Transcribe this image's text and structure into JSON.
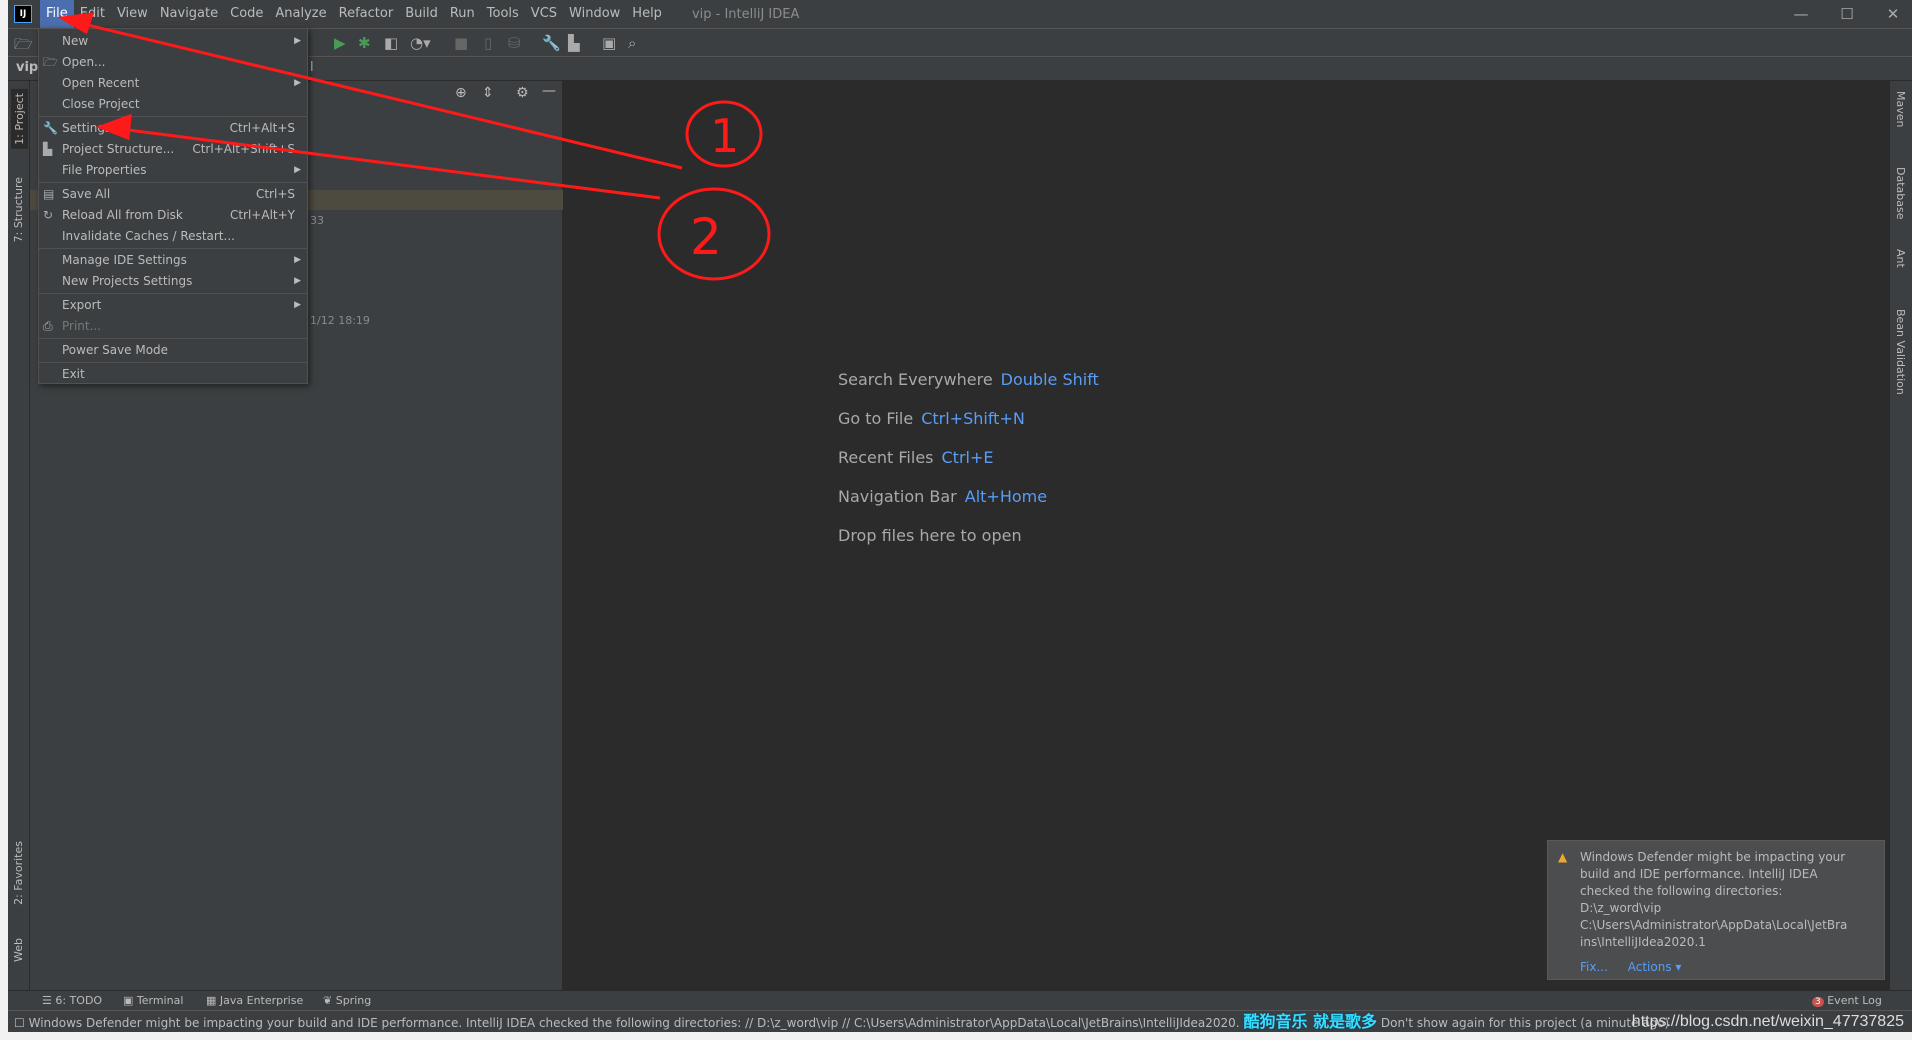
{
  "window": {
    "title": "vip - IntelliJ IDEA",
    "logo": "IJ"
  },
  "menubar": [
    "File",
    "Edit",
    "View",
    "Navigate",
    "Code",
    "Analyze",
    "Refactor",
    "Build",
    "Run",
    "Tools",
    "VCS",
    "Window",
    "Help"
  ],
  "navbar": {
    "project": "vip",
    "crumb_fragment": "l"
  },
  "left_stripe": {
    "project": "1: Project",
    "structure": "7: Structure",
    "favorites": "2: Favorites",
    "web": "Web"
  },
  "right_stripe": [
    "Maven",
    "Database",
    "Ant",
    "Bean Validation"
  ],
  "project_panel": {
    "text1": "33",
    "text2": "1/12 18:19"
  },
  "file_menu": [
    {
      "label": "New",
      "arrow": true
    },
    {
      "label": "Open...",
      "icon": "folder-icon"
    },
    {
      "label": "Open Recent",
      "arrow": true
    },
    {
      "label": "Close Project"
    },
    {
      "label": "Settings...",
      "shortcut": "Ctrl+Alt+S",
      "icon": "wrench-icon"
    },
    {
      "label": "Project Structure...",
      "shortcut": "Ctrl+Alt+Shift+S",
      "icon": "project-structure-icon"
    },
    {
      "label": "File Properties",
      "arrow": true
    },
    {
      "label": "Save All",
      "shortcut": "Ctrl+S",
      "icon": "save-icon"
    },
    {
      "label": "Reload All from Disk",
      "shortcut": "Ctrl+Alt+Y",
      "icon": "reload-icon"
    },
    {
      "label": "Invalidate Caches / Restart..."
    },
    {
      "label": "Manage IDE Settings",
      "arrow": true
    },
    {
      "label": "New Projects Settings",
      "arrow": true
    },
    {
      "label": "Export",
      "arrow": true
    },
    {
      "label": "Print...",
      "icon": "print-icon",
      "disabled": true
    },
    {
      "label": "Power Save Mode"
    },
    {
      "label": "Exit"
    }
  ],
  "editor_hints": [
    {
      "text": "Search Everywhere",
      "key": "Double Shift"
    },
    {
      "text": "Go to File",
      "key": "Ctrl+Shift+N"
    },
    {
      "text": "Recent Files",
      "key": "Ctrl+E"
    },
    {
      "text": "Navigation Bar",
      "key": "Alt+Home"
    },
    {
      "text": "Drop files here to open",
      "key": ""
    }
  ],
  "annotations": [
    "1",
    "2"
  ],
  "notification": {
    "lines": [
      "Windows Defender might be impacting your",
      "build and IDE performance. IntelliJ IDEA",
      "checked the following directories:",
      "D:\\z_word\\vip",
      "C:\\Users\\Administrator\\AppData\\Local\\JetBra",
      "ins\\IntelliJIdea2020.1"
    ],
    "fix": "Fix...",
    "actions": "Actions"
  },
  "bottom_tabs": [
    "6: TODO",
    "Terminal",
    "Java Enterprise",
    "Spring"
  ],
  "event_log": {
    "label": "Event Log",
    "count": "3"
  },
  "status": {
    "message": "Windows Defender might be impacting your build and IDE performance. IntelliJ IDEA checked the following directories: // D:\\z_word\\vip // C:\\Users\\Administrator\\AppData\\Local\\JetBrains\\IntelliJIdea2020.",
    "overlay": "酷狗音乐 就是歌多",
    "tail": "Don't show again for this project (a minute ago)",
    "watermark": "https://blog.csdn.net/weixin_47737825"
  },
  "colors": {
    "accent": "#4b6eaf",
    "link": "#589df6",
    "annotation": "#ff0000"
  }
}
